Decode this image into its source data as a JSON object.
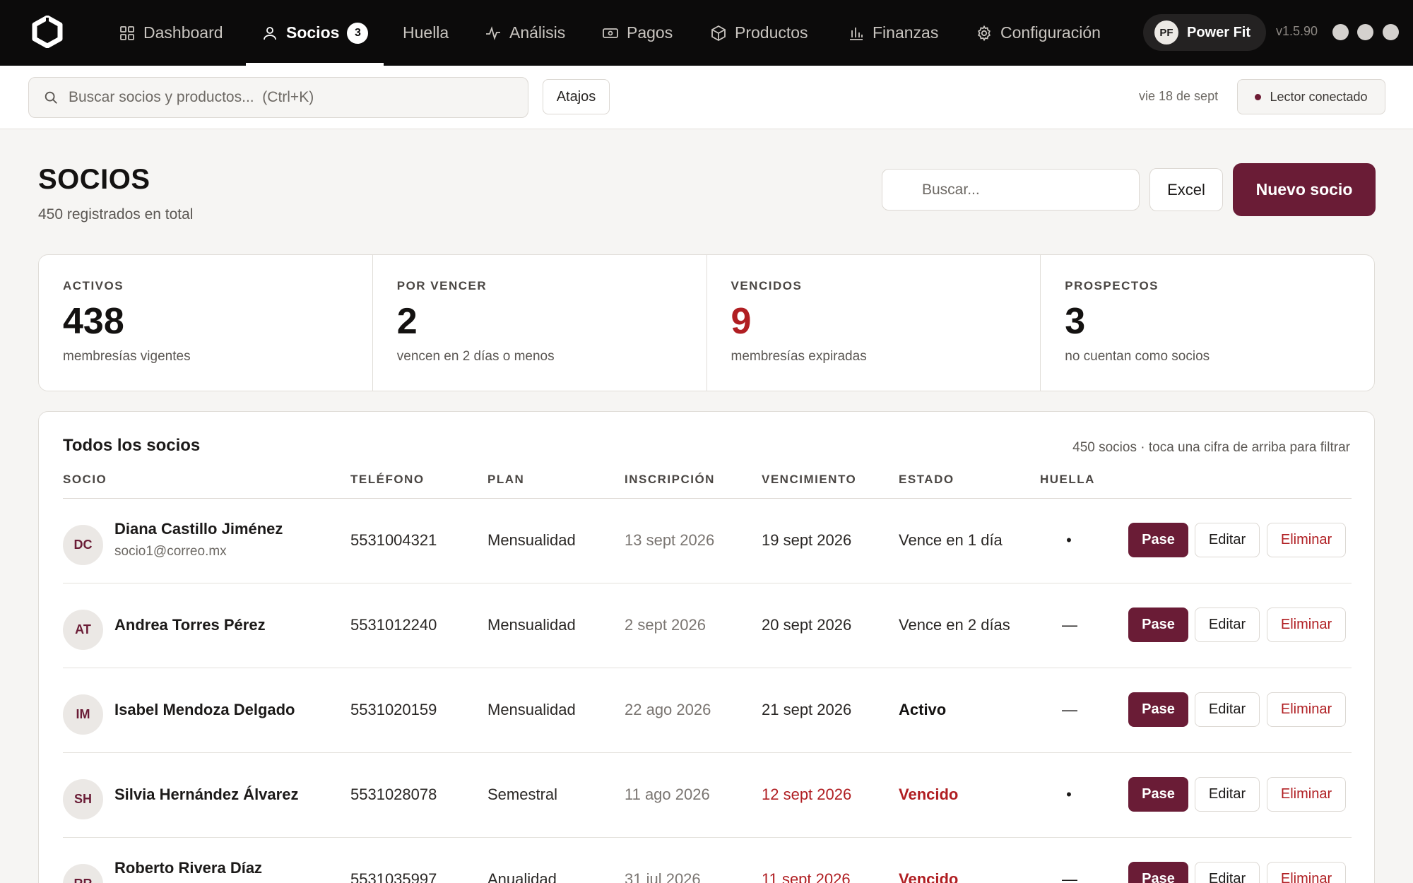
{
  "nav": {
    "items": [
      {
        "label": "Dashboard",
        "icon": "grid-icon"
      },
      {
        "label": "Socios",
        "icon": "user-icon",
        "badge": "3",
        "active": true
      },
      {
        "label": "Huella"
      },
      {
        "label": "Análisis",
        "icon": "activity-icon"
      },
      {
        "label": "Pagos",
        "icon": "money-icon"
      },
      {
        "label": "Productos",
        "icon": "box-icon"
      },
      {
        "label": "Finanzas",
        "icon": "bar-chart-icon"
      },
      {
        "label": "Configuración",
        "icon": "gear-icon"
      }
    ],
    "profile": {
      "initials": "PF",
      "name": "Power Fit"
    },
    "version": "v1.5.90"
  },
  "subbar": {
    "search_placeholder": "Buscar socios y productos...  (Ctrl+K)",
    "shortcuts_label": "Atajos",
    "date": "vie 18 de sept",
    "reader_status": "Lector conectado"
  },
  "page": {
    "title": "SOCIOS",
    "subtitle": "450 registrados en total",
    "search_placeholder": "Buscar...",
    "excel_label": "Excel",
    "new_member_label": "Nuevo socio"
  },
  "stats": [
    {
      "label": "ACTIVOS",
      "value": "438",
      "desc": "membresías vigentes"
    },
    {
      "label": "POR VENCER",
      "value": "2",
      "desc": "vencen en 2 días o menos"
    },
    {
      "label": "VENCIDOS",
      "value": "9",
      "desc": "membresías expiradas"
    },
    {
      "label": "PROSPECTOS",
      "value": "3",
      "desc": "no cuentan como socios"
    }
  ],
  "table": {
    "title": "Todos los socios",
    "hint": "450 socios · toca una cifra de arriba para filtrar",
    "columns": [
      "SOCIO",
      "TELÉFONO",
      "PLAN",
      "INSCRIPCIÓN",
      "VENCIMIENTO",
      "ESTADO",
      "HUELLA"
    ],
    "actions": {
      "pass": "Pase",
      "edit": "Editar",
      "delete": "Eliminar"
    },
    "rows": [
      {
        "initials": "DC",
        "name": "Diana Castillo Jiménez",
        "email": "socio1@correo.mx",
        "phone": "5531004321",
        "plan": "Mensualidad",
        "signup": "13 sept 2026",
        "expires": "19 sept 2026",
        "status": "Vence en 1 día",
        "fingerprint": "•"
      },
      {
        "initials": "AT",
        "name": "Andrea Torres Pérez",
        "email": "",
        "phone": "5531012240",
        "plan": "Mensualidad",
        "signup": "2 sept 2026",
        "expires": "20 sept 2026",
        "status": "Vence en 2 días",
        "fingerprint": "—"
      },
      {
        "initials": "IM",
        "name": "Isabel Mendoza Delgado",
        "email": "",
        "phone": "5531020159",
        "plan": "Mensualidad",
        "signup": "22 ago 2026",
        "expires": "21 sept 2026",
        "status": "Activo",
        "fingerprint": "—"
      },
      {
        "initials": "SH",
        "name": "Silvia Hernández Álvarez",
        "email": "",
        "phone": "5531028078",
        "plan": "Semestral",
        "signup": "11 ago 2026",
        "expires": "12 sept 2026",
        "status": "Vencido",
        "fingerprint": "•"
      },
      {
        "initials": "RR",
        "name": "Roberto Rivera Díaz",
        "email": "",
        "phone": "5531035997",
        "plan": "Anualidad",
        "signup": "31 jul 2026",
        "expires": "11 sept 2026",
        "status": "Vencido",
        "fingerprint": "—"
      }
    ]
  },
  "colors": {
    "brand": "#6a1c36",
    "danger": "#b01e22",
    "topbar": "#0c0b0b"
  }
}
